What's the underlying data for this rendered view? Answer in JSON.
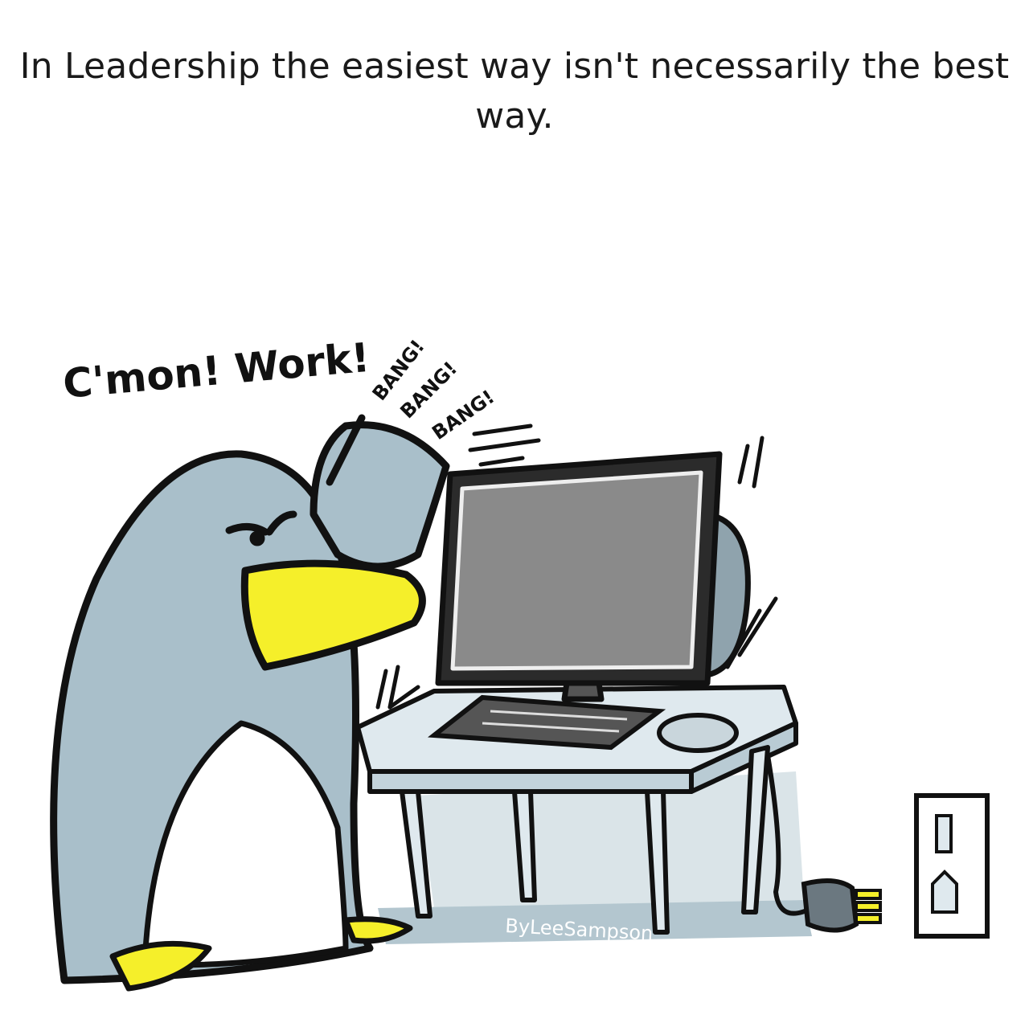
{
  "caption": "In Leadership the easiest way isn't necessarily the best way.",
  "speech": "C'mon! Work!",
  "sound_effects": [
    "BANG!",
    "BANG!",
    "BANG!"
  ],
  "signature": "ByLeeSampson",
  "colors": {
    "penguin_body": "#a9bfca",
    "penguin_belly": "#ffffff",
    "beak": "#f5ef2a",
    "shadow": "#a6bcc7",
    "screen": "#8a8a8a",
    "outline": "#111111"
  }
}
